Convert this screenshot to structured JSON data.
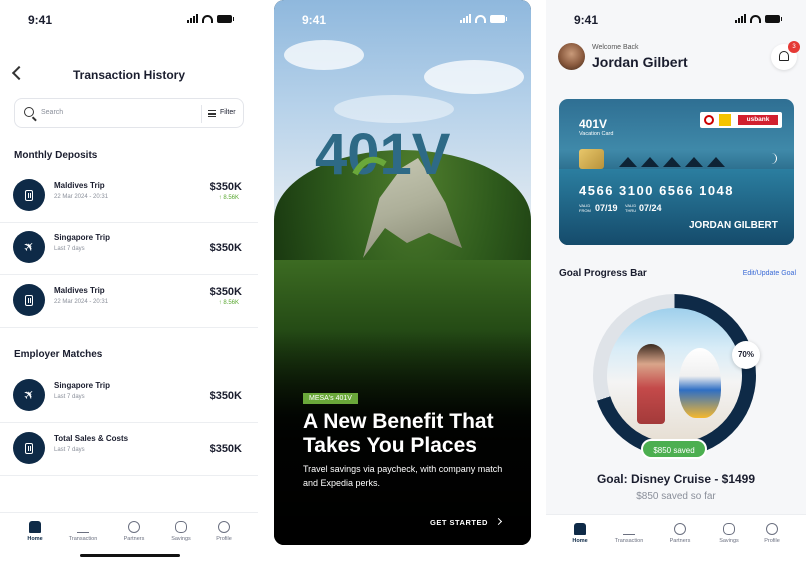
{
  "status": {
    "time": "9:41"
  },
  "screen1": {
    "title": "Transaction History",
    "search_placeholder": "Search",
    "filter_label": "Filter",
    "section_deposits": "Monthly Deposits",
    "section_matches": "Employer Matches",
    "deposits": [
      {
        "name": "Maldives Trip",
        "date": "22 Mar 2024 - 20:31",
        "amount": "$350K",
        "change": "8.56K",
        "icon": "bag-icon"
      },
      {
        "name": "Singapore Trip",
        "date": "Last 7 days",
        "amount": "$350K",
        "change": "",
        "icon": "plane-icon"
      },
      {
        "name": "Maldives Trip",
        "date": "22 Mar 2024 - 20:31",
        "amount": "$350K",
        "change": "8.56K",
        "icon": "bag-icon"
      }
    ],
    "matches": [
      {
        "name": "Singapore Trip",
        "date": "Last 7 days",
        "amount": "$350K",
        "icon": "plane-icon"
      },
      {
        "name": "Total Sales & Costs",
        "date": "Last 7 days",
        "amount": "$350K",
        "icon": "bag-icon"
      }
    ]
  },
  "tabs": [
    "Home",
    "Transaction",
    "Partners",
    "Savings",
    "Profile"
  ],
  "screen2": {
    "logo_text": "401V",
    "tag": "MESA's 401V",
    "headline": "A New Benefit That Takes You Places",
    "subtext": "Travel savings via paycheck, with company match and Expedia perks.",
    "cta": "GET STARTED"
  },
  "screen3": {
    "welcome": "Welcome Back",
    "name": "Jordan Gilbert",
    "notification_count": "3",
    "card": {
      "brand": "401V",
      "type": "Vacation Card",
      "partner_bank": "usbank",
      "number": "4566  3100  6566  1048",
      "valid_label_1": "VALID",
      "valid_label_2": "FROM",
      "valid_from": "07/19",
      "thru_label_1": "VALID",
      "thru_label_2": "THRU",
      "valid_thru": "07/24",
      "holder": "JORDAN GILBERT"
    },
    "goal_section_title": "Goal Progress Bar",
    "goal_edit_link": "Edit/Update Goal",
    "goal_progress_percent": "70%",
    "goal_progress_value": 0.7,
    "saved_pill": "$850 saved",
    "goal_name": "Goal: Disney Cruise - $1499",
    "goal_saved": "$850 saved so far"
  },
  "colors": {
    "navy": "#0e2a47",
    "green": "#6aa83a",
    "accent_blue": "#3b6bd6",
    "success": "#4caf50"
  }
}
